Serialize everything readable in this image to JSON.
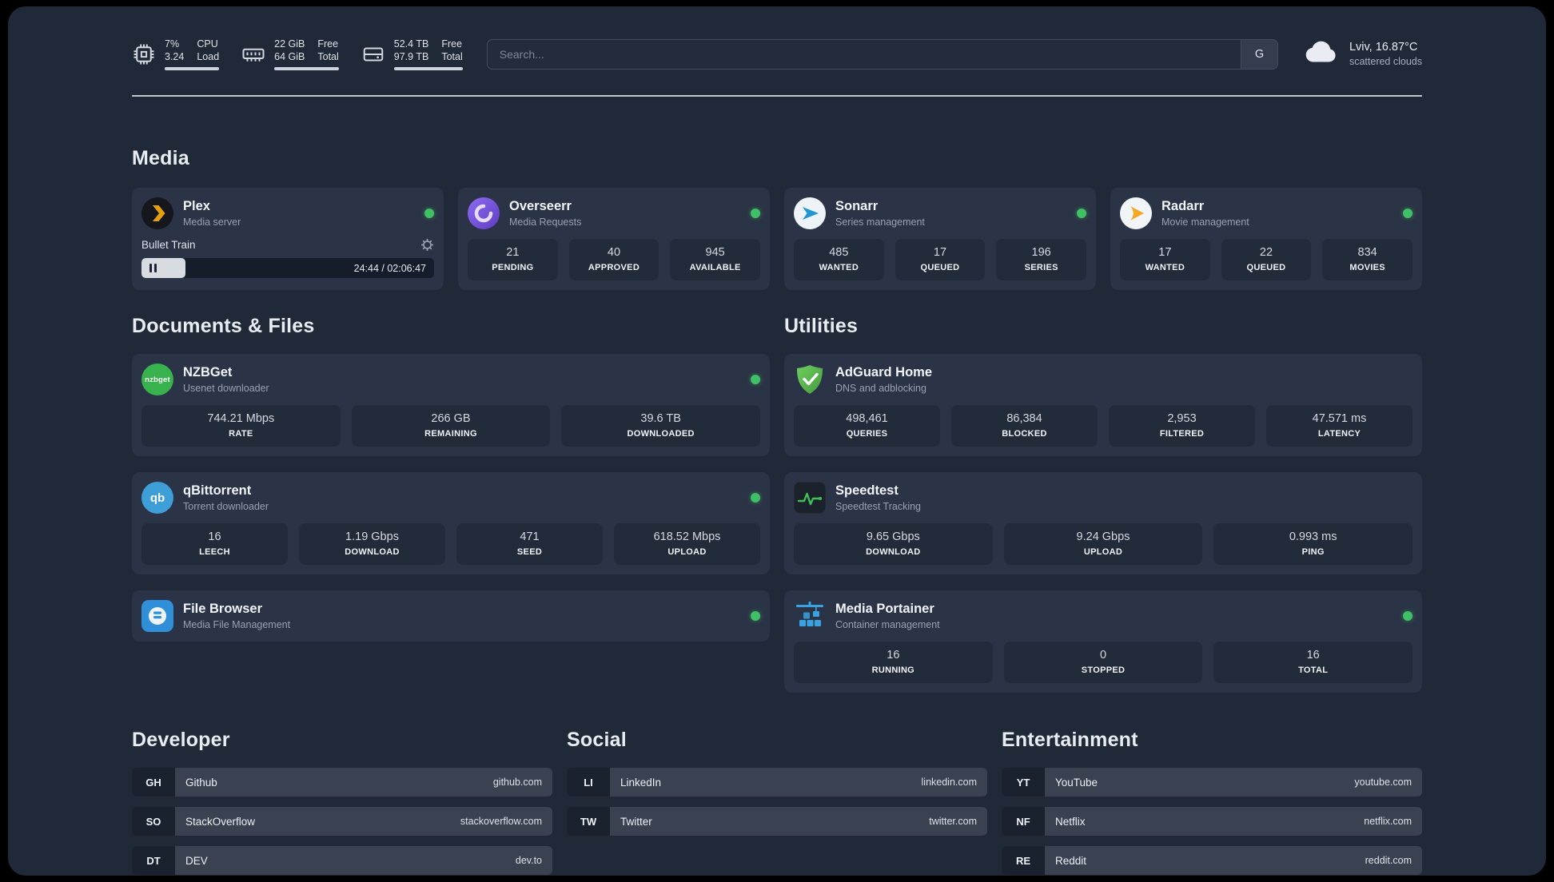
{
  "header": {
    "cpu": {
      "value": "7%",
      "value2": "3.24",
      "label": "CPU",
      "label2": "Load"
    },
    "ram": {
      "value": "22 GiB",
      "value2": "64 GiB",
      "label": "Free",
      "label2": "Total"
    },
    "disk": {
      "value": "52.4 TB",
      "value2": "97.9 TB",
      "label": "Free",
      "label2": "Total"
    },
    "search": {
      "placeholder": "Search...",
      "engine_button": "G"
    },
    "weather": {
      "location": "Lviv, 16.87°C",
      "condition": "scattered clouds"
    }
  },
  "media": {
    "title": "Media",
    "plex": {
      "name": "Plex",
      "subtitle": "Media server",
      "now_playing": "Bullet Train",
      "time": "24:44 / 02:06:47"
    },
    "overseerr": {
      "name": "Overseerr",
      "subtitle": "Media Requests",
      "stats": [
        {
          "value": "21",
          "label": "PENDING"
        },
        {
          "value": "40",
          "label": "APPROVED"
        },
        {
          "value": "945",
          "label": "AVAILABLE"
        }
      ]
    },
    "sonarr": {
      "name": "Sonarr",
      "subtitle": "Series management",
      "stats": [
        {
          "value": "485",
          "label": "WANTED"
        },
        {
          "value": "17",
          "label": "QUEUED"
        },
        {
          "value": "196",
          "label": "SERIES"
        }
      ]
    },
    "radarr": {
      "name": "Radarr",
      "subtitle": "Movie management",
      "stats": [
        {
          "value": "17",
          "label": "WANTED"
        },
        {
          "value": "22",
          "label": "QUEUED"
        },
        {
          "value": "834",
          "label": "MOVIES"
        }
      ]
    }
  },
  "documents": {
    "title": "Documents & Files",
    "nzbget": {
      "name": "NZBGet",
      "subtitle": "Usenet downloader",
      "icon_text": "nzbget",
      "stats": [
        {
          "value": "744.21 Mbps",
          "label": "RATE"
        },
        {
          "value": "266 GB",
          "label": "REMAINING"
        },
        {
          "value": "39.6 TB",
          "label": "DOWNLOADED"
        }
      ]
    },
    "qbittorrent": {
      "name": "qBittorrent",
      "subtitle": "Torrent downloader",
      "icon_text": "qb",
      "stats": [
        {
          "value": "16",
          "label": "LEECH"
        },
        {
          "value": "1.19 Gbps",
          "label": "DOWNLOAD"
        },
        {
          "value": "471",
          "label": "SEED"
        },
        {
          "value": "618.52 Mbps",
          "label": "UPLOAD"
        }
      ]
    },
    "filebrowser": {
      "name": "File Browser",
      "subtitle": "Media File Management"
    }
  },
  "utilities": {
    "title": "Utilities",
    "adguard": {
      "name": "AdGuard Home",
      "subtitle": "DNS and adblocking",
      "stats": [
        {
          "value": "498,461",
          "label": "QUERIES"
        },
        {
          "value": "86,384",
          "label": "BLOCKED"
        },
        {
          "value": "2,953",
          "label": "FILTERED"
        },
        {
          "value": "47.571 ms",
          "label": "LATENCY"
        }
      ]
    },
    "speedtest": {
      "name": "Speedtest",
      "subtitle": "Speedtest Tracking",
      "stats": [
        {
          "value": "9.65 Gbps",
          "label": "DOWNLOAD"
        },
        {
          "value": "9.24 Gbps",
          "label": "UPLOAD"
        },
        {
          "value": "0.993 ms",
          "label": "PING"
        }
      ]
    },
    "portainer": {
      "name": "Media Portainer",
      "subtitle": "Container management",
      "stats": [
        {
          "value": "16",
          "label": "RUNNING"
        },
        {
          "value": "0",
          "label": "STOPPED"
        },
        {
          "value": "16",
          "label": "TOTAL"
        }
      ]
    }
  },
  "bookmarks": {
    "developer": {
      "title": "Developer",
      "links": [
        {
          "abbr": "GH",
          "name": "Github",
          "url": "github.com"
        },
        {
          "abbr": "SO",
          "name": "StackOverflow",
          "url": "stackoverflow.com"
        },
        {
          "abbr": "DT",
          "name": "DEV",
          "url": "dev.to"
        }
      ]
    },
    "social": {
      "title": "Social",
      "links": [
        {
          "abbr": "LI",
          "name": "LinkedIn",
          "url": "linkedin.com"
        },
        {
          "abbr": "TW",
          "name": "Twitter",
          "url": "twitter.com"
        }
      ]
    },
    "entertainment": {
      "title": "Entertainment",
      "links": [
        {
          "abbr": "YT",
          "name": "YouTube",
          "url": "youtube.com"
        },
        {
          "abbr": "NF",
          "name": "Netflix",
          "url": "netflix.com"
        },
        {
          "abbr": "RE",
          "name": "Reddit",
          "url": "reddit.com"
        }
      ]
    }
  },
  "colors": {
    "status_online": "#3fbf66",
    "panel_bg": "#202938",
    "card_bg": "#2b3446",
    "tile_bg": "#222b3a"
  }
}
